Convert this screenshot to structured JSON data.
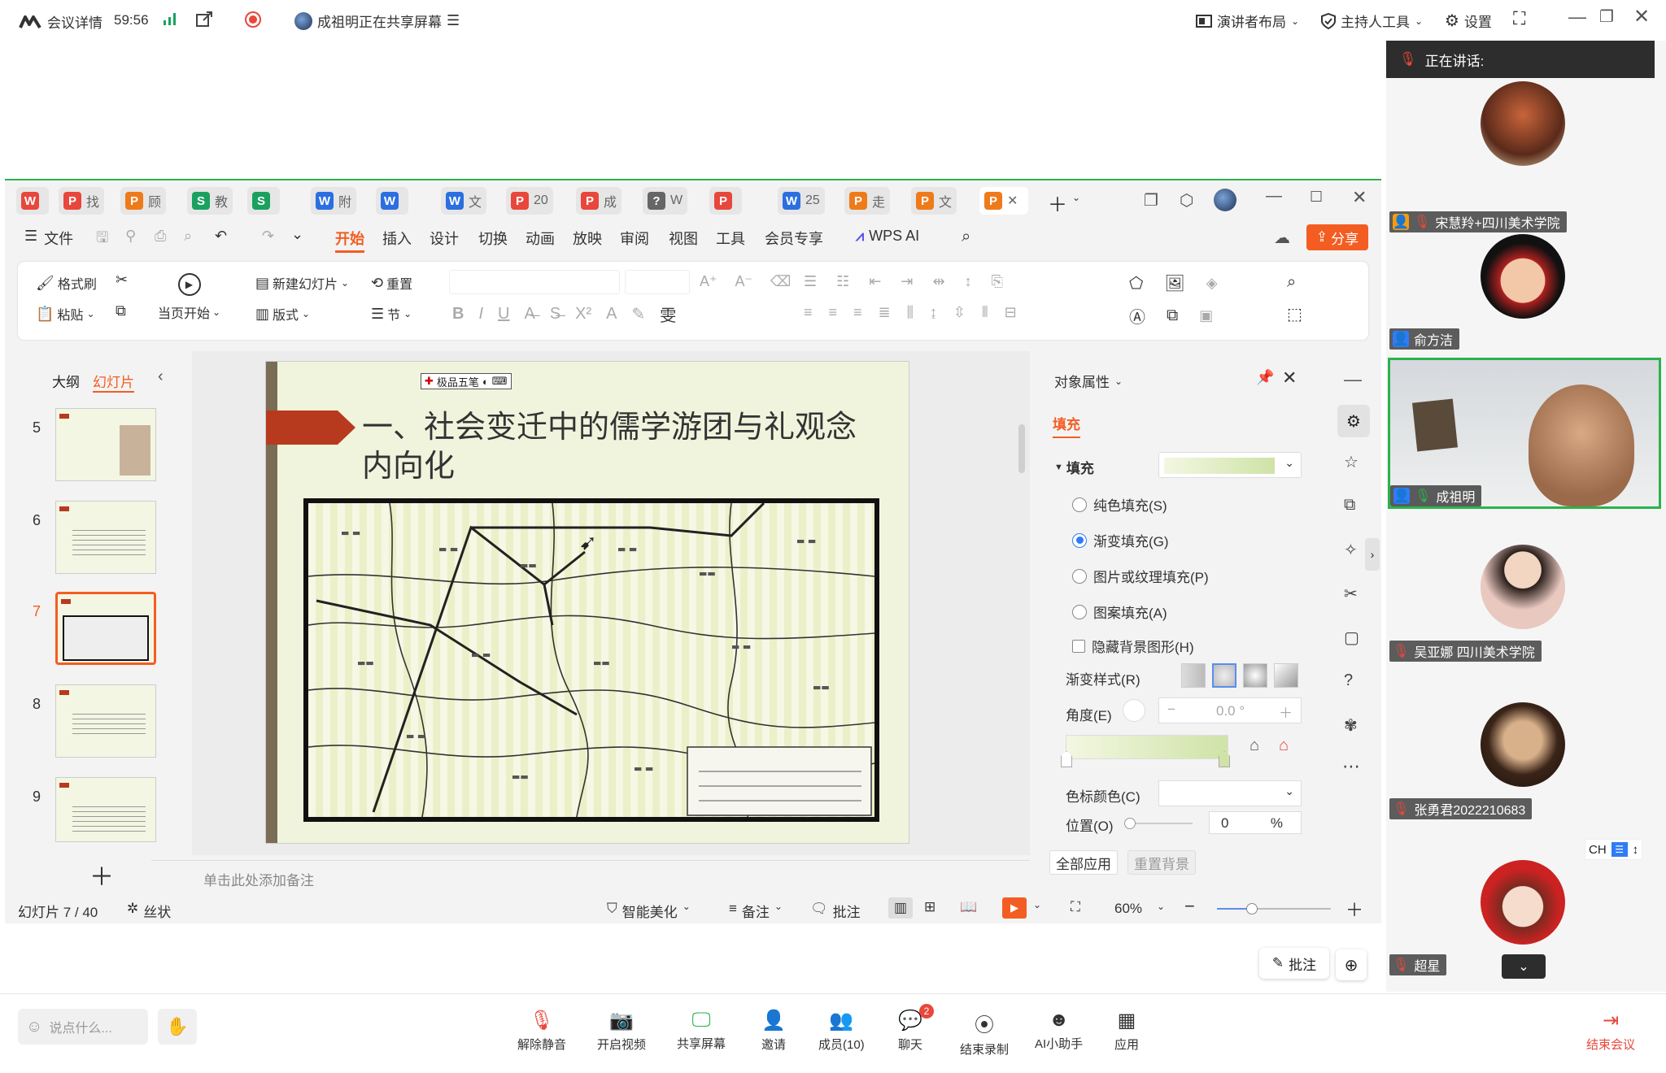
{
  "meeting": {
    "details_label": "会议详情",
    "timer": "59:56",
    "sharing_text": "成祖明正在共享屏幕",
    "layout_label": "演讲者布局",
    "host_tools_label": "主持人工具",
    "settings_label": "设置"
  },
  "wps": {
    "file_tabs": [
      {
        "badge": "W",
        "color": "#e8473b",
        "label": ""
      },
      {
        "badge": "P",
        "color": "#e8473b",
        "label": "找"
      },
      {
        "badge": "P",
        "color": "#ef7a1a",
        "label": "顾"
      },
      {
        "badge": "S",
        "color": "#1aa15f",
        "label": "教"
      },
      {
        "badge": "S",
        "color": "#1aa15f",
        "label": ""
      },
      {
        "badge": "W",
        "color": "#2b6fe0",
        "label": "附"
      },
      {
        "badge": "W",
        "color": "#2b6fe0",
        "label": ""
      },
      {
        "badge": "W",
        "color": "#2b6fe0",
        "label": "文"
      },
      {
        "badge": "P",
        "color": "#e8473b",
        "label": "20"
      },
      {
        "badge": "P",
        "color": "#e8473b",
        "label": "成"
      },
      {
        "badge": "?",
        "color": "#666666",
        "label": "W"
      },
      {
        "badge": "P",
        "color": "#e8473b",
        "label": ""
      },
      {
        "badge": "W",
        "color": "#2b6fe0",
        "label": "25"
      },
      {
        "badge": "P",
        "color": "#ef7a1a",
        "label": "走"
      },
      {
        "badge": "P",
        "color": "#ef7a1a",
        "label": "文"
      },
      {
        "badge": "P",
        "color": "#ef7a1a",
        "label": ""
      }
    ],
    "menu": {
      "file": "文件",
      "items": [
        "开始",
        "插入",
        "设计",
        "切换",
        "动画",
        "放映",
        "审阅",
        "视图",
        "工具",
        "会员专享"
      ],
      "ai": "WPS AI",
      "share": "分享"
    },
    "ribbon": {
      "format_painter": "格式刷",
      "paste": "粘贴",
      "play_from_current": "当页开始",
      "new_slide": "新建幻灯片",
      "layout": "版式",
      "reset": "重置",
      "section": "节"
    },
    "thumbs": {
      "tab_outline": "大纲",
      "tab_slides": "幻灯片",
      "numbers": [
        "5",
        "6",
        "7",
        "8",
        "9"
      ]
    },
    "slide": {
      "toolbar_label": "极品五笔",
      "title": "一、社会变迁中的儒学游团与礼观念内向化"
    },
    "notes_placeholder": "单击此处添加备注",
    "props": {
      "title": "对象属性",
      "tab_fill": "填充",
      "fill_label": "填充",
      "options": [
        "纯色填充(S)",
        "渐变填充(G)",
        "图片或纹理填充(P)",
        "图案填充(A)"
      ],
      "hide_bg": "隐藏背景图形(H)",
      "gradient_style": "渐变样式(R)",
      "angle_label": "角度(E)",
      "angle_value": "0.0 °",
      "stop_color": "色标颜色(C)",
      "position_label": "位置(O)",
      "position_value": "0",
      "position_unit": "%",
      "apply_all": "全部应用",
      "reset_bg": "重置背景"
    },
    "status": {
      "slide_counter": "幻灯片 7 / 40",
      "theme": "丝状",
      "smart": "智能美化",
      "notes": "备注",
      "comment": "批注",
      "zoom": "60%"
    }
  },
  "participants": {
    "speaking_label": "正在讲话:",
    "list": [
      {
        "name": "宋慧羚+四川美术学院",
        "host": true,
        "muted": true
      },
      {
        "name": "俞方洁",
        "host": true,
        "muted": false
      },
      {
        "name": "成祖明",
        "host": true,
        "muted": false
      },
      {
        "name": "吴亚娜  四川美术学院",
        "host": false,
        "muted": true
      },
      {
        "name": "张勇君2022210683",
        "host": false,
        "muted": true
      },
      {
        "name": "超星",
        "host": false,
        "muted": true
      }
    ],
    "ime": "CH"
  },
  "annotate_label": "批注",
  "bottom": {
    "chat_placeholder": "说点什么...",
    "buttons": [
      "解除静音",
      "开启视频",
      "共享屏幕",
      "邀请",
      "成员(10)",
      "聊天",
      "结束录制",
      "AI小助手",
      "应用"
    ],
    "chat_badge": "2",
    "end_meeting": "结束会议"
  }
}
